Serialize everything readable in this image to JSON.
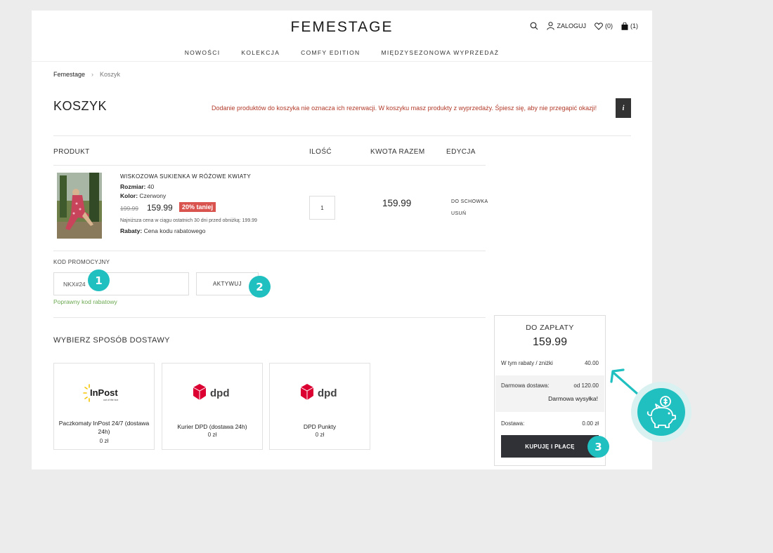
{
  "header": {
    "logo": "FEMESTAGE",
    "login_label": "ZALOGUJ",
    "wishlist_count": "(0)",
    "cart_count": "(1)"
  },
  "nav": {
    "items": [
      "NOWOŚCI",
      "KOLEKCJA",
      "COMFY EDITION",
      "MIĘDZYSEZONOWA WYPRZEDAŻ"
    ]
  },
  "breadcrumb": {
    "home": "Femestage",
    "separator": "›",
    "current": "Koszyk"
  },
  "cart": {
    "title": "KOSZYK",
    "notice": "Dodanie produktów do koszyka nie oznacza ich rezerwacji. W koszyku masz produkty z wyprzedaży. Śpiesz się, aby nie przegapić okazji!",
    "info_icon": "i",
    "columns": {
      "product": "PRODUKT",
      "quantity": "ILOŚĆ",
      "total": "KWOTA RAZEM",
      "edit": "EDYCJA"
    },
    "item": {
      "name": "WISKOZOWA SUKIENKA W RÓŻOWE KWIATY",
      "size_label": "Rozmiar:",
      "size_value": "40",
      "color_label": "Kolor:",
      "color_value": "Czerwony",
      "old_price": "199.99",
      "price": "159.99",
      "discount_badge": "20% taniej",
      "lowest_price_note": "Najniższa cena w ciągu ostatnich 30 dni przed obniżką: 199.99",
      "discount_label": "Rabaty:",
      "discount_value": "Cena kodu rabatowego",
      "quantity": "1",
      "line_total": "159.99",
      "action_save": "DO SCHOWKA",
      "action_remove": "USUŃ"
    }
  },
  "promo": {
    "label": "KOD PROMOCYJNY",
    "code_value": "NKX#24",
    "apply_label": "AKTYWUJ",
    "success_message": "Poprawny kod rabatowy"
  },
  "shipping": {
    "title": "WYBIERZ SPOSÓB DOSTAWY",
    "options": [
      {
        "logo_text": "InPost",
        "logo_tagline": "out of the box",
        "name": "Paczkomaty InPost 24/7 (dostawa 24h)",
        "price": "0 zł"
      },
      {
        "logo_text": "dpd",
        "name": "Kurier DPD (dostawa 24h)",
        "price": "0 zł"
      },
      {
        "logo_text": "dpd",
        "name": "DPD Punkty",
        "price": "0 zł"
      }
    ]
  },
  "summary": {
    "title": "DO ZAPŁATY",
    "total": "159.99",
    "discounts_label": "W tym rabaty / zniżki",
    "discounts_value": "40.00",
    "free_shipping_label": "Darmowa dostawa:",
    "free_shipping_value": "od 120.00",
    "free_shipping_note": "Darmowa wysyłka!",
    "shipping_label": "Dostawa:",
    "shipping_value": "0.00 zł",
    "checkout_label": "KUPUJĘ I PŁACĘ"
  },
  "annotations": {
    "marker_1": "1",
    "marker_2": "2",
    "marker_3": "3"
  },
  "colors": {
    "accent_teal": "#20bfc0",
    "notice_red": "#b23a2a",
    "badge_red": "#d9534f",
    "success_green": "#6aa84f",
    "button_dark": "#2f3136"
  }
}
